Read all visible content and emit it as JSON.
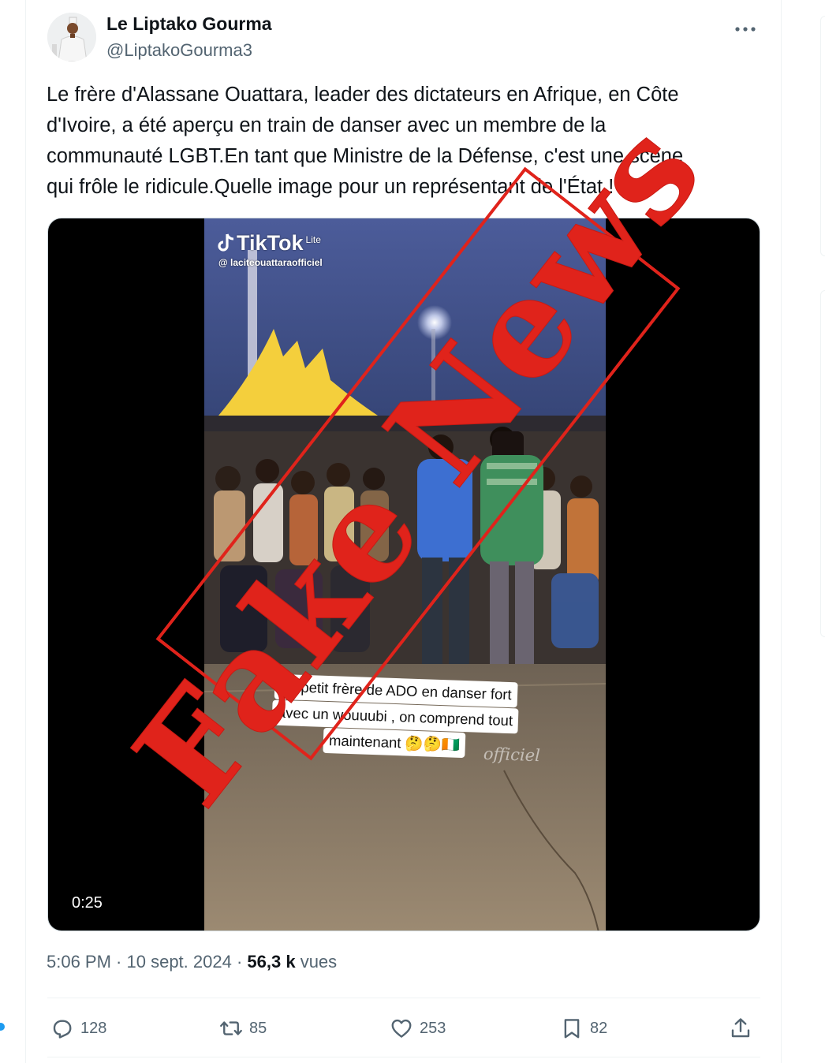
{
  "author": {
    "name": "Le Liptako Gourma",
    "handle": "@LiptakoGourma3"
  },
  "tweet": {
    "text_lines": [
      "Le frère d'Alassane Ouattara, leader des dictateurs en Afrique, en Côte",
      "d'Ivoire, a été aperçu en train de danser avec un membre de la",
      "communauté LGBT.En tant que Ministre de la Défense, c'est une scène",
      "qui frôle le ridicule.Quelle image pour un représentant de l'État !"
    ]
  },
  "media": {
    "tiktok_label": "TikTok",
    "tiktok_sublabel": "Lite",
    "tiktok_handle": "@ laciteouattaraofficiel",
    "caption_lines": [
      "Le petit frère de ADO en danser fort",
      "avec un wouuubi , on comprend tout",
      "maintenant 🤔🤔🇨🇮"
    ],
    "watermark": "officiel",
    "duration": "0:25",
    "stamp_text": "Fake News",
    "stamp_color": "#e0231b"
  },
  "meta": {
    "time": "5:06 PM",
    "separator": " · ",
    "date": "10 sept. 2024",
    "separator2": " · ",
    "views_count": "56,3 k",
    "views_label": " vues"
  },
  "actions": {
    "replies": "128",
    "reposts": "85",
    "likes": "253",
    "bookmarks": "82"
  },
  "colors": {
    "text_primary": "#0f1419",
    "text_secondary": "#536471",
    "accent": "#1d9bf0",
    "border": "#eff3f4"
  }
}
